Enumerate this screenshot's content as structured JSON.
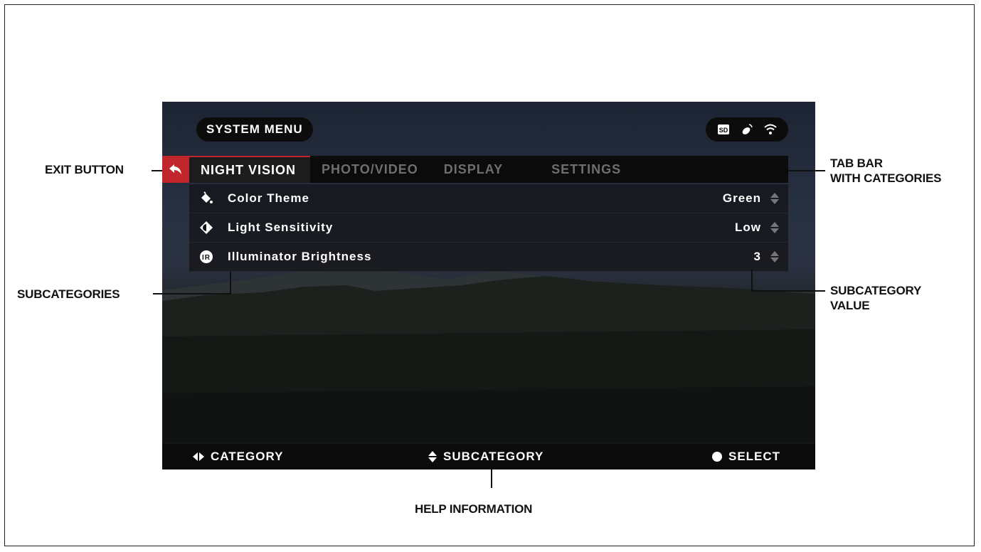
{
  "screen": {
    "title": "SYSTEM MENU",
    "status_icons": [
      "sd-card-icon",
      "gps-signal-icon",
      "wifi-icon"
    ],
    "tabs": [
      {
        "label": "NIGHT VISION",
        "active": true
      },
      {
        "label": "PHOTO/VIDEO",
        "active": false
      },
      {
        "label": "DISPLAY",
        "active": false
      },
      {
        "label": "SETTINGS",
        "active": false
      }
    ],
    "rows": [
      {
        "icon": "paint-bucket-icon",
        "label": "Color Theme",
        "value": "Green"
      },
      {
        "icon": "contrast-icon",
        "label": "Light Sensitivity",
        "value": "Low"
      },
      {
        "icon": "ir-icon",
        "label": "Illuminator Brightness",
        "value": "3"
      }
    ],
    "help": {
      "category": "CATEGORY",
      "subcategory": "SUBCATEGORY",
      "select": "SELECT"
    }
  },
  "annotations": {
    "exit_button": "EXIT BUTTON",
    "tab_bar_1": "TAB BAR",
    "tab_bar_2": "WITH CATEGORIES",
    "subcategories": "SUBCATEGORIES",
    "subcategory_value_1": "SUBCATEGORY",
    "subcategory_value_2": "VALUE",
    "help_information": "HELP INFORMATION"
  },
  "colors": {
    "accent_red": "#c0262b",
    "bar_black": "#0b0b0b"
  }
}
